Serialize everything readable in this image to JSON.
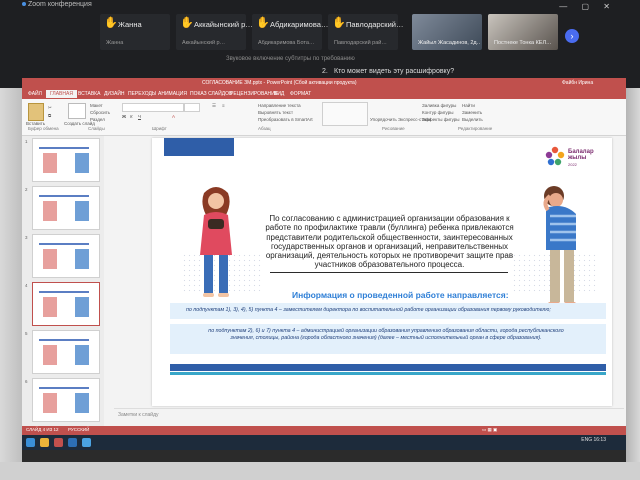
{
  "conference": {
    "title": "Zoom конференция",
    "participants": [
      {
        "name": "Жанна",
        "sub": "Жанна"
      },
      {
        "name": "Аккайынский р…",
        "sub": "Аккайынский р…"
      },
      {
        "name": "Абдикаримова…",
        "sub": "Абдикаримова Бота…"
      },
      {
        "name": "Павлодарский…",
        "sub": "Павлодарский рай…"
      },
      {
        "name": "",
        "sub": "Жайыл Жасадинов, 2д…"
      },
      {
        "name": "",
        "sub": "Постнеке Тонка КЕЛ…"
      }
    ],
    "caption_hint": "Звуковое включение субтитры по требованию",
    "caption_number": "2.",
    "caption_question": "Кто может видеть эту расшифровку?"
  },
  "ppt": {
    "title": "СОГЛАСОВАНИЕ ЗМ.pptx - PowerPoint (Сбой активации продукта)",
    "user": "Файбн Ирина",
    "tabs": [
      "ФАЙЛ",
      "ГЛАВНАЯ",
      "ВСТАВКА",
      "ДИЗАЙН",
      "ПЕРЕХОДЫ",
      "АНИМАЦИЯ",
      "ПОКАЗ СЛАЙДОВ",
      "РЕЦЕНЗИРОВАНИЕ",
      "ВИД",
      "ФОРМАТ"
    ],
    "active_tab": "ГЛАВНАЯ",
    "ribbon": {
      "paste": "Вставить",
      "create_slide": "Создать слайд",
      "groups": [
        "Буфер обмена",
        "Слайды",
        "Шрифт",
        "Абзац",
        "Рисование",
        "Редактирование"
      ],
      "layout": "Макет",
      "reset": "Сбросить",
      "section": "Раздел",
      "text_direction": "Направление текста",
      "align_text": "Выровнять текст",
      "smartart": "Преобразовать в SmartArt",
      "arrange": "Упорядочить",
      "express_styles": "Экспресс-стили",
      "fill": "Заливка фигуры",
      "outline": "Контур фигуры",
      "effects": "Эффекты фигуры",
      "find": "Найти",
      "replace": "Заменить",
      "select": "Выделить"
    },
    "thumb_numbers": [
      "1",
      "2",
      "3",
      "4",
      "5",
      "6"
    ],
    "notes_placeholder": "Заметки к слайду",
    "status_left": "СЛАЙД 4 ИЗ 12",
    "status_lang": "РУССКИЙ",
    "clock_time": "16:13",
    "clock_lang": "ENG"
  },
  "slide": {
    "logo_text": "Балалар жылы",
    "logo_year": "2022",
    "main_text": "По согласованию с администрацией организации образования к работе по профилактике травли (буллинга) ребенка привлекаются представители родительской общественности, заинтересованных государственных органов и организаций, неправительственных организаций, деятельность которых не противоречит защите прав участников образовательного процесса.",
    "info_heading": "Информация о проведенной работе направляется:",
    "info_row1": "по подпунктам 1), 3), 4), 5) пункта 4 – заместителем директора по воспитательной работе организации образования первому руководителю;",
    "info_row2": "по подпунктам 2), 6) и 7) пункта 4 – администрацией организации образования управлению образования области, города республиканского значения, столицы, района (города областного значения) (далее – местный исполнительный орган в сфере образования)."
  },
  "colors": {
    "ppt_accent": "#c0504d",
    "slide_blue": "#2f5ea8",
    "heading_blue": "#2f7fd6",
    "raise_hand": "#ff7a3d"
  }
}
